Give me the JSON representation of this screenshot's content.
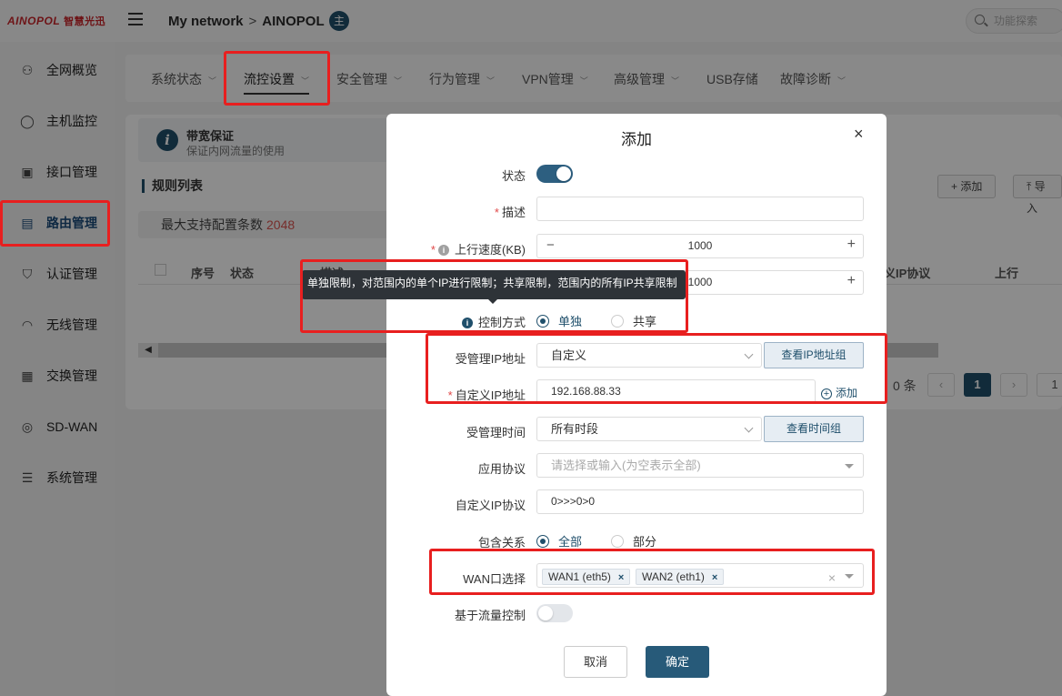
{
  "topbar": {
    "logo_latin": "AINOPOL",
    "logo_cn": "智慧光迅",
    "breadcrumb": [
      "My network",
      "AINOPOL"
    ],
    "avatar": "主",
    "search_placeholder": "功能探索"
  },
  "sidebar": {
    "items": [
      {
        "label": "全网概览",
        "icon": "topology-icon"
      },
      {
        "label": "主机监控",
        "icon": "user-icon"
      },
      {
        "label": "接口管理",
        "icon": "interface-icon"
      },
      {
        "label": "路由管理",
        "icon": "router-icon",
        "active": true
      },
      {
        "label": "认证管理",
        "icon": "shield-icon"
      },
      {
        "label": "无线管理",
        "icon": "wifi-icon"
      },
      {
        "label": "交换管理",
        "icon": "switch-icon"
      },
      {
        "label": "SD-WAN",
        "icon": "sdwan-icon"
      },
      {
        "label": "系统管理",
        "icon": "settings-icon"
      }
    ]
  },
  "tabs": [
    {
      "label": "系统状态"
    },
    {
      "label": "流控设置",
      "active": true
    },
    {
      "label": "安全管理"
    },
    {
      "label": "行为管理"
    },
    {
      "label": "VPN管理"
    },
    {
      "label": "高级管理"
    },
    {
      "label": "USB存储"
    },
    {
      "label": "故障诊断"
    }
  ],
  "page": {
    "info_title": "带宽保证",
    "info_subtitle": "保证内网流量的使用",
    "section_title": "规则列表",
    "max_label": "最大支持配置条数",
    "max_value": "2048",
    "add_button": "+ 添加",
    "import_button": "导入",
    "table_headers": [
      "序号",
      "状态",
      "描述",
      "义IP协议",
      "上行"
    ],
    "pager_count": "0 条",
    "pager_current": "1",
    "pager_jump": "1"
  },
  "modal": {
    "title": "添加",
    "close": "×",
    "status_label": "状态",
    "status_on": true,
    "desc_label": "描述",
    "desc_value": "",
    "up_label": "上行速度(KB)",
    "up_value": "1000",
    "down_value": "1000",
    "tooltip": "单独限制，对范围内的单个IP进行限制；共享限制，范围内的所有IP共享限制",
    "control_label": "控制方式",
    "control_options": [
      "单独",
      "共享"
    ],
    "control_selected": "单独",
    "managed_ip_label": "受管理IP地址",
    "managed_ip_value": "自定义",
    "view_ip_group": "查看IP地址组",
    "custom_ip_label": "自定义IP地址",
    "custom_ip_value": "192.168.88.33",
    "add_link": "添加",
    "managed_time_label": "受管理时间",
    "managed_time_value": "所有时段",
    "view_time_group": "查看时间组",
    "app_protocol_label": "应用协议",
    "app_protocol_placeholder": "请选择或输入(为空表示全部)",
    "custom_ip_proto_label": "自定义IP协议",
    "custom_ip_proto_value": "0>>>0>0",
    "include_label": "包含关系",
    "include_options": [
      "全部",
      "部分"
    ],
    "include_selected": "全部",
    "wan_label": "WAN口选择",
    "wan_tags": [
      "WAN1 (eth5)",
      "WAN2 (eth1)"
    ],
    "flow_control_label": "基于流量控制",
    "flow_control_on": false,
    "cancel": "取消",
    "confirm": "确定"
  },
  "colors": {
    "accent": "#1f4f6b",
    "highlight": "#e81f1f",
    "required": "#e04848"
  }
}
